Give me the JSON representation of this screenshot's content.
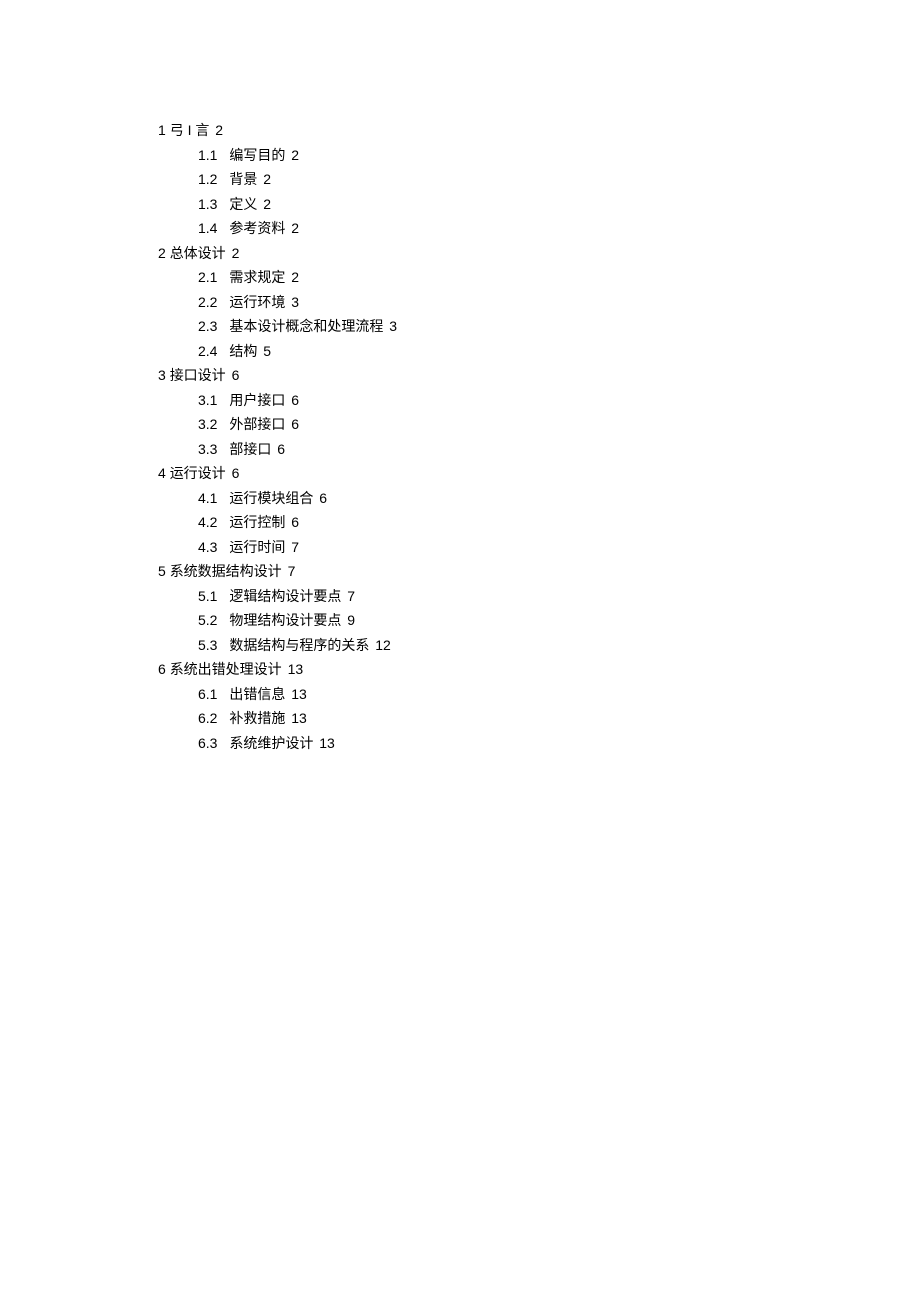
{
  "toc": [
    {
      "num": "1",
      "title": "弓 I 言",
      "page": "2",
      "subs": [
        {
          "num": "1.1",
          "title": "编写目的",
          "page": "2"
        },
        {
          "num": "1.2",
          "title": "背景",
          "page": "2"
        },
        {
          "num": "1.3",
          "title": "定义",
          "page": "2"
        },
        {
          "num": "1.4",
          "title": "参考资料",
          "page": "2"
        }
      ]
    },
    {
      "num": "2",
      "title": "总体设计",
      "page": "2",
      "subs": [
        {
          "num": "2.1",
          "title": "需求规定",
          "page": "2"
        },
        {
          "num": "2.2",
          "title": "运行环境",
          "page": "3"
        },
        {
          "num": "2.3",
          "title": "基本设计概念和处理流程",
          "page": "3"
        },
        {
          "num": "2.4",
          "title": "结构",
          "page": "5"
        }
      ]
    },
    {
      "num": "3",
      "title": "接口设计",
      "page": "6",
      "subs": [
        {
          "num": "3.1",
          "title": "用户接口",
          "page": "6"
        },
        {
          "num": "3.2",
          "title": "外部接口",
          "page": "6"
        },
        {
          "num": "3.3",
          "title": "部接口",
          "page": "6"
        }
      ]
    },
    {
      "num": "4",
      "title": "运行设计",
      "page": "6",
      "subs": [
        {
          "num": "4.1",
          "title": "运行模块组合",
          "page": "6"
        },
        {
          "num": "4.2",
          "title": "运行控制",
          "page": "6"
        },
        {
          "num": "4.3",
          "title": "运行时间",
          "page": "7"
        }
      ]
    },
    {
      "num": "5",
      "title": "系统数据结构设计",
      "page": "7",
      "subs": [
        {
          "num": "5.1",
          "title": "逻辑结构设计要点",
          "page": "7"
        },
        {
          "num": "5.2",
          "title": "物理结构设计要点",
          "page": "9"
        },
        {
          "num": "5.3",
          "title": "数据结构与程序的关系",
          "page": "12"
        }
      ]
    },
    {
      "num": "6",
      "title": "系统出错处理设计",
      "page": "13",
      "subs": [
        {
          "num": "6.1",
          "title": "出错信息",
          "page": "13"
        },
        {
          "num": "6.2",
          "title": "补救措施",
          "page": "13"
        },
        {
          "num": "6.3",
          "title": "系统维护设计",
          "page": "13"
        }
      ]
    }
  ]
}
